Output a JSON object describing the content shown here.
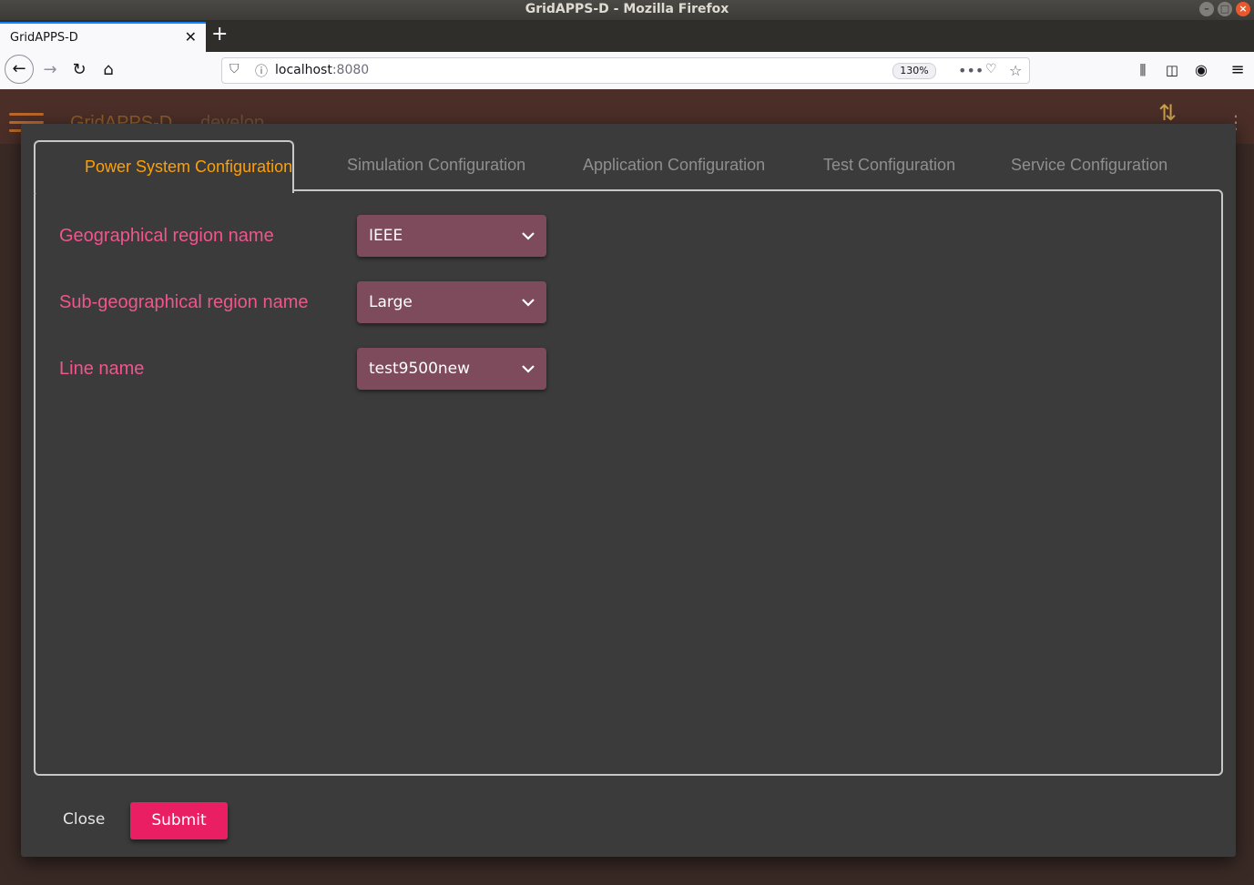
{
  "window": {
    "title": "GridAPPS-D - Mozilla Firefox"
  },
  "browser": {
    "tab_title": "GridAPPS-D",
    "new_tab_label": "+",
    "url_host": "localhost",
    "url_port": ":8080",
    "zoom": "130%"
  },
  "app": {
    "title": "GridAPPS-D",
    "subtitle": "develop"
  },
  "dialog": {
    "tabs": [
      {
        "label": "Power System Configuration",
        "active": true
      },
      {
        "label": "Simulation Configuration",
        "active": false
      },
      {
        "label": "Application Configuration",
        "active": false
      },
      {
        "label": "Test Configuration",
        "active": false
      },
      {
        "label": "Service Configuration",
        "active": false
      }
    ],
    "fields": [
      {
        "label": "Geographical region name",
        "value": "IEEE"
      },
      {
        "label": "Sub-geographical region name",
        "value": "Large"
      },
      {
        "label": "Line name",
        "value": "test9500new"
      }
    ],
    "close_label": "Close",
    "submit_label": "Submit"
  },
  "colors": {
    "active_tab": "#ffa000",
    "field_label": "#f0558c",
    "select_bg": "#7d4b5c",
    "submit_bg": "#e91e63"
  }
}
